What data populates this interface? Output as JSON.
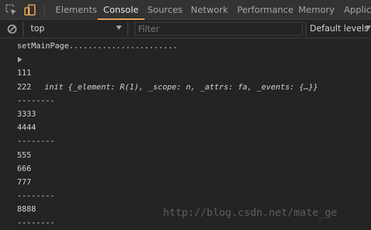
{
  "toolbar": {
    "inspect_icon": "inspect-element-icon",
    "device_icon": "device-toolbar-icon",
    "tabs": [
      {
        "label": "Elements"
      },
      {
        "label": "Console"
      },
      {
        "label": "Sources"
      },
      {
        "label": "Network"
      },
      {
        "label": "Performance"
      },
      {
        "label": "Memory"
      },
      {
        "label": "Applica"
      }
    ],
    "active_tab": "Console",
    "accent_color": "#f0a35a",
    "device_icon_color": "#f0a35a"
  },
  "filter_bar": {
    "clear_icon": "clear-console-icon",
    "context": "top",
    "filter_placeholder": "Filter",
    "levels": "Default levels"
  },
  "console": {
    "lines": [
      {
        "text": "setMainPage......................."
      },
      {
        "text": "init {_element: R(1), _scope: n, _attrs: fa, _events: {…}}"
      },
      {
        "text": "111"
      },
      {
        "text": "222"
      },
      {
        "text": "--------"
      },
      {
        "text": "3333"
      },
      {
        "text": "4444"
      },
      {
        "text": "--------"
      },
      {
        "text": "555"
      },
      {
        "text": "666"
      },
      {
        "text": "777"
      },
      {
        "text": "--------"
      },
      {
        "text": "8888"
      },
      {
        "text": "--------"
      }
    ]
  },
  "watermark": "http://blog.csdn.net/mate_ge"
}
